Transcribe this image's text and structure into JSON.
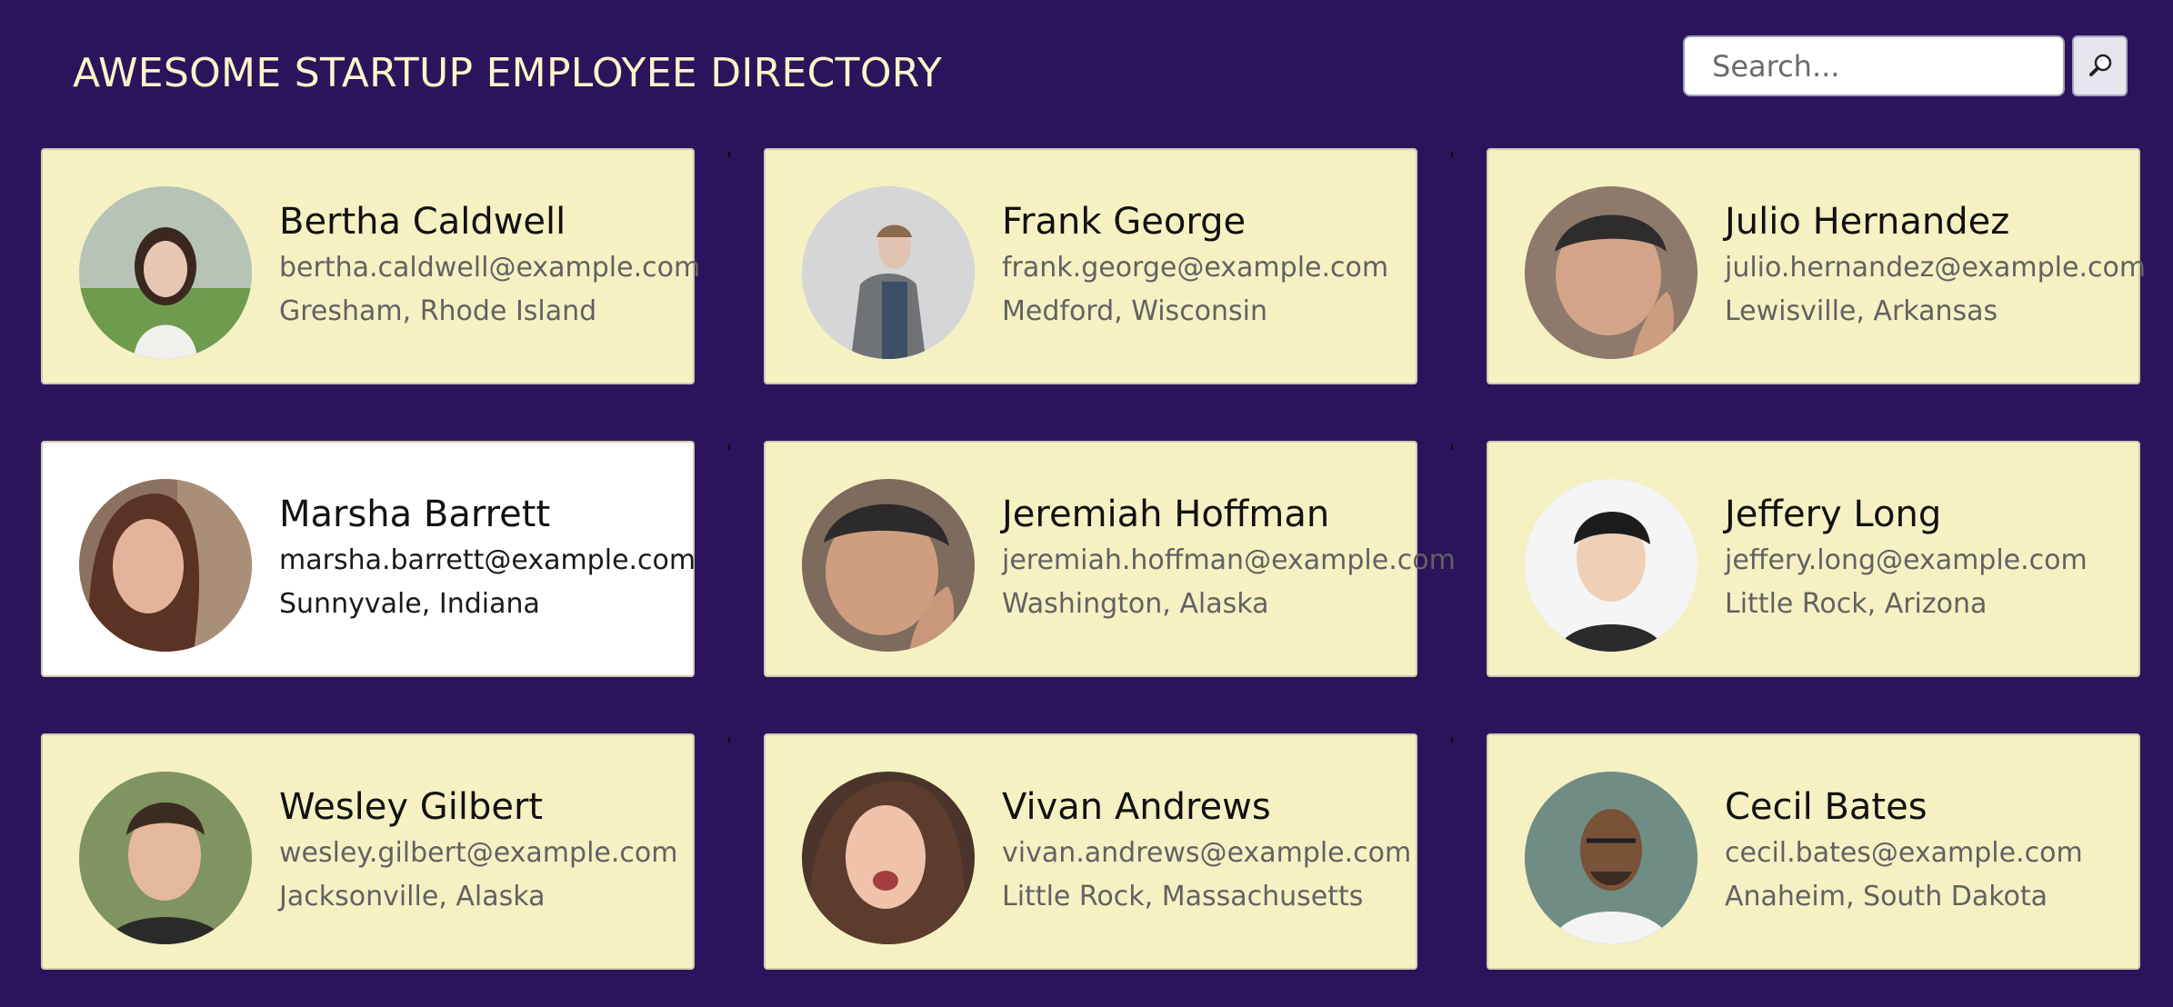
{
  "header": {
    "title": "AWESOME STARTUP EMPLOYEE DIRECTORY"
  },
  "search": {
    "placeholder": "Search...",
    "button_icon": "magnifier-icon"
  },
  "employees": [
    {
      "name": "Bertha Caldwell",
      "email": "bertha.caldwell@example.com",
      "location": "Gresham, Rhode Island",
      "selected": false
    },
    {
      "name": "Frank George",
      "email": "frank.george@example.com",
      "location": "Medford, Wisconsin",
      "selected": false
    },
    {
      "name": "Julio Hernandez",
      "email": "julio.hernandez@example.com",
      "location": "Lewisville, Arkansas",
      "selected": false
    },
    {
      "name": "Marsha Barrett",
      "email": "marsha.barrett@example.com",
      "location": "Sunnyvale, Indiana",
      "selected": true
    },
    {
      "name": "Jeremiah Hoffman",
      "email": "jeremiah.hoffman@example.com",
      "location": "Washington, Alaska",
      "selected": false
    },
    {
      "name": "Jeffery Long",
      "email": "jeffery.long@example.com",
      "location": "Little Rock, Arizona",
      "selected": false
    },
    {
      "name": "Wesley Gilbert",
      "email": "wesley.gilbert@example.com",
      "location": "Jacksonville, Alaska",
      "selected": false
    },
    {
      "name": "Vivan Andrews",
      "email": "vivan.andrews@example.com",
      "location": "Little Rock, Massachusetts",
      "selected": false
    },
    {
      "name": "Cecil Bates",
      "email": "cecil.bates@example.com",
      "location": "Anaheim, South Dakota",
      "selected": false
    }
  ],
  "colors": {
    "background": "#2b145c",
    "title": "#fff5c9",
    "card": "#f5f1c3",
    "card_selected": "#ffffff"
  }
}
